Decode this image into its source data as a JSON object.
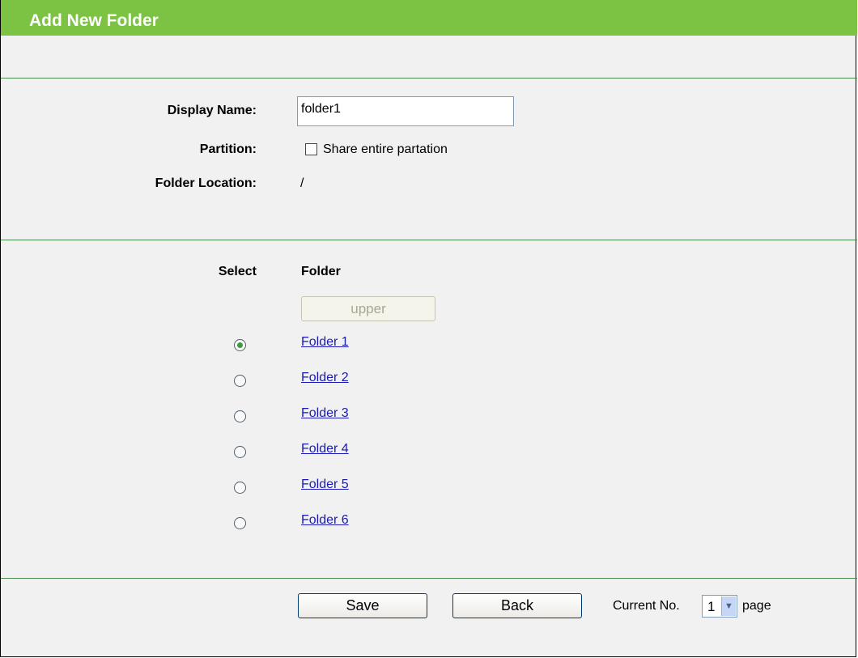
{
  "header": {
    "title": "Add New Folder"
  },
  "form": {
    "display_name_label": "Display Name:",
    "display_name_value": "folder1",
    "partition_label": "Partition:",
    "partition_checkbox_label": "Share entire partation",
    "folder_location_label": "Folder Location:",
    "folder_location_value": "/"
  },
  "folders": {
    "select_header": "Select",
    "folder_header": "Folder",
    "upper_button": "upper",
    "items": [
      {
        "label": "Folder 1",
        "selected": true
      },
      {
        "label": "Folder 2",
        "selected": false
      },
      {
        "label": "Folder 3",
        "selected": false
      },
      {
        "label": "Folder 4",
        "selected": false
      },
      {
        "label": "Folder 5",
        "selected": false
      },
      {
        "label": "Folder 6",
        "selected": false
      }
    ]
  },
  "footer": {
    "save_label": "Save",
    "back_label": "Back",
    "current_no_label": "Current No.",
    "page_value": "1",
    "page_suffix": "page"
  },
  "colors": {
    "header_green": "#7cc243",
    "divider_green": "#4a8a4a",
    "link_blue": "#1a1ab8"
  }
}
